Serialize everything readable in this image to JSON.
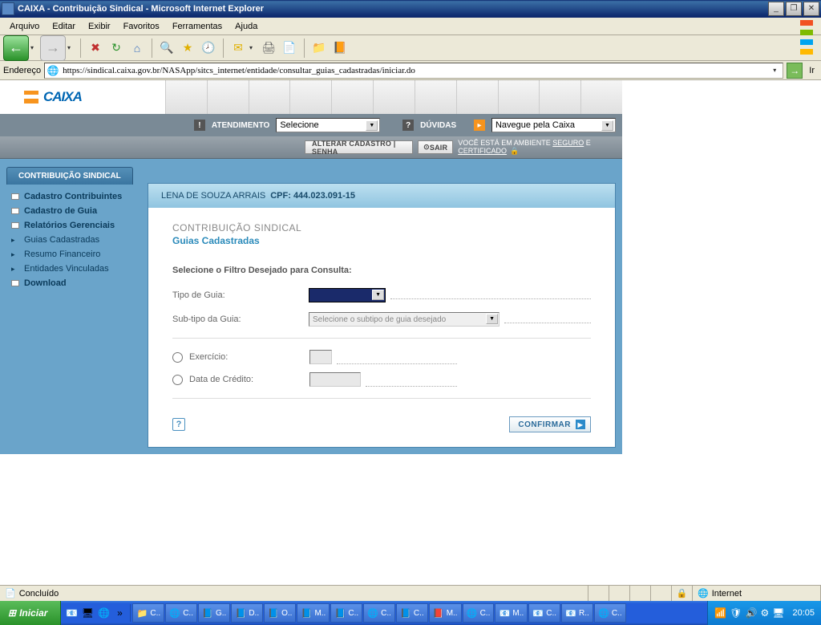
{
  "window": {
    "title": "CAIXA - Contribuição Sindical - Microsoft Internet Explorer"
  },
  "menu": {
    "items": [
      "Arquivo",
      "Editar",
      "Exibir",
      "Favoritos",
      "Ferramentas",
      "Ajuda"
    ]
  },
  "addressbar": {
    "label": "Endereço",
    "url": "https://sindical.caixa.gov.br/NASApp/sitcs_internet/entidade/consultar_guias_cadastradas/iniciar.do",
    "go_label": "Ir"
  },
  "app_nav": {
    "atendimento_label": "ATENDIMENTO",
    "atendimento_placeholder": "Selecione",
    "duvidas_label": "DÚVIDAS",
    "navegue_placeholder": "Navegue pela Caixa"
  },
  "app_toolbar": {
    "alterar_label": "ALTERAR CADASTRO | SENHA",
    "sair_label": "SAIR",
    "secure_prefix": "VOCÊ ESTÁ EM AMBIENTE ",
    "seguro": "SEGURO",
    "secure_mid": " E ",
    "certificado": "CERTIFICADO"
  },
  "page_tab": "CONTRIBUIÇÃO SINDICAL",
  "sidebar": {
    "items": [
      {
        "label": "Cadastro Contribuintes",
        "bold": true,
        "icon": "box"
      },
      {
        "label": "Cadastro de Guia",
        "bold": true,
        "icon": "box"
      },
      {
        "label": "Relatórios Gerenciais",
        "bold": true,
        "icon": "box"
      },
      {
        "label": "Guias Cadastradas",
        "bold": false,
        "icon": "arrow"
      },
      {
        "label": "Resumo Financeiro",
        "bold": false,
        "icon": "arrow"
      },
      {
        "label": "Entidades Vinculadas",
        "bold": false,
        "icon": "arrow"
      },
      {
        "label": "Download",
        "bold": true,
        "icon": "box"
      }
    ]
  },
  "panel": {
    "user_name": "LENA DE SOUZA ARRAIS",
    "cpf_label": "CPF: 444.023.091-15",
    "title1": "CONTRIBUIÇÃO SINDICAL",
    "title2": "Guias Cadastradas",
    "subhead": "Selecione o Filtro Desejado para Consulta:",
    "tipo_guia_label": "Tipo de Guia:",
    "subtipo_label": "Sub-tipo da Guia:",
    "subtipo_placeholder": "Selecione o subtipo de guia desejado",
    "exercicio_label": "Exercício:",
    "data_credito_label": "Data de Crédito:",
    "confirm_label": "CONFIRMAR"
  },
  "statusbar": {
    "status": "Concluído",
    "zone": "Internet"
  },
  "taskbar": {
    "start": "Iniciar",
    "tasks": [
      "C..",
      "C..",
      "G..",
      "D..",
      "O..",
      "M..",
      "C..",
      "C..",
      "C..",
      "M..",
      "C..",
      "M..",
      "C..",
      "R..",
      "C.."
    ],
    "clock": "20:05"
  }
}
